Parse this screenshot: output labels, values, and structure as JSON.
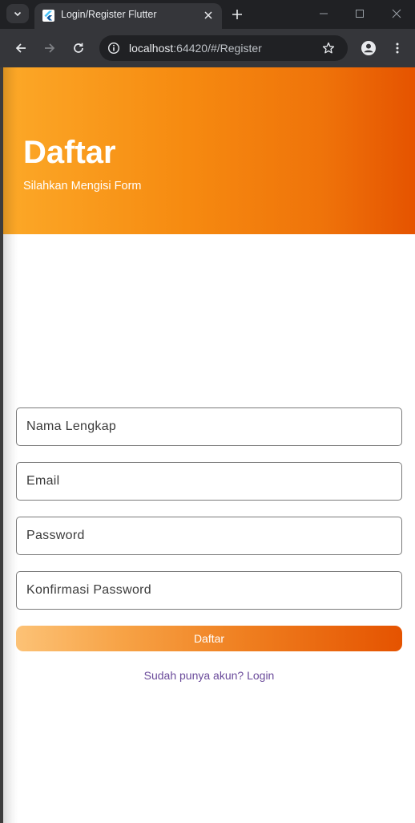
{
  "browser": {
    "tab_title": "Login/Register Flutter",
    "url_host": "localhost",
    "url_path": ":64420/#/Register",
    "icons": {
      "tab_list": "chevron-down-icon",
      "favicon": "flutter-icon",
      "tab_close": "close-icon",
      "new_tab": "plus-icon",
      "minimize": "minimize-icon",
      "maximize": "maximize-icon",
      "close_window": "close-icon",
      "back": "arrow-left-icon",
      "forward": "arrow-right-icon",
      "reload": "reload-icon",
      "site_info": "info-icon",
      "bookmark": "star-icon",
      "profile": "person-icon",
      "menu": "more-vert-icon"
    },
    "colors": {
      "tab_strip": "#202124",
      "toolbar": "#35363a"
    }
  },
  "page": {
    "header": {
      "title": "Daftar",
      "subtitle": "Silahkan Mengisi Form",
      "gradient": [
        "#fca928",
        "#e55300"
      ]
    },
    "form": {
      "full_name_placeholder": "Nama Lengkap",
      "email_placeholder": "Email",
      "password_placeholder": "Password",
      "confirm_password_placeholder": "Konfirmasi Password",
      "submit_label": "Daftar",
      "submit_gradient": [
        "#fcc276",
        "#e55300"
      ]
    },
    "login_link": "Sudah punya akun? Login",
    "link_color": "#6a4a9a"
  }
}
